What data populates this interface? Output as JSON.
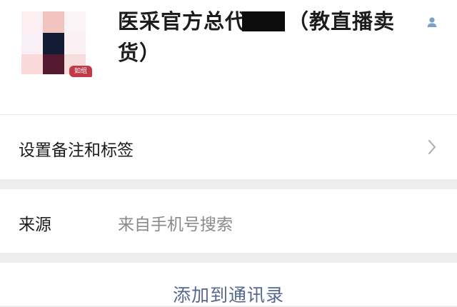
{
  "contact": {
    "name_line1_prefix": "医采官方总代",
    "name_line1_suffix": "（教直播卖",
    "name_line2": "货）",
    "badge": "如组"
  },
  "icons": {
    "person": "person-icon",
    "chevron": "chevron-right-icon"
  },
  "rows": {
    "remark_label": "设置备注和标签",
    "source_label": "来源",
    "source_value": "来自手机号搜索"
  },
  "actions": {
    "add_to_contacts": "添加到通讯录"
  },
  "colors": {
    "link": "#56688f",
    "badge": "#c23a47",
    "background": "#ededed"
  }
}
